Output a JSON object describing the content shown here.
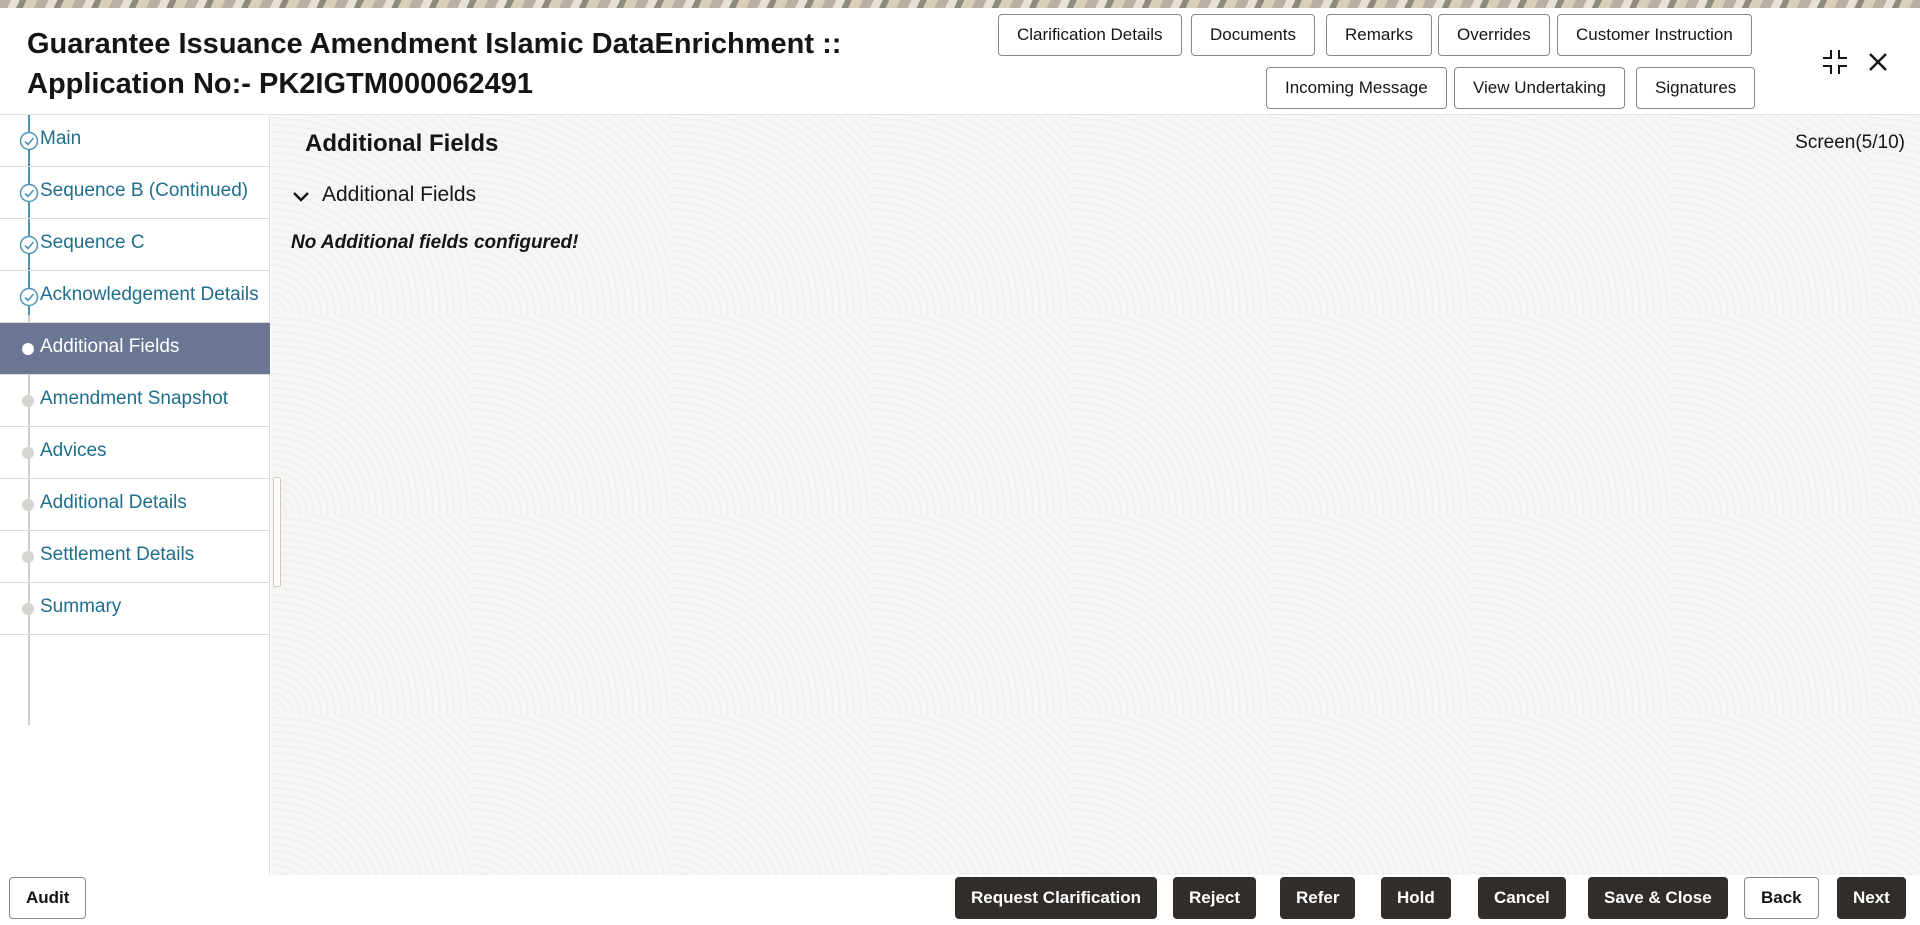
{
  "header": {
    "title_line1": "Guarantee Issuance Amendment Islamic DataEnrichment ::",
    "title_line2": "Application No:- PK2IGTM000062491",
    "buttons": {
      "clarification_details": "Clarification Details",
      "documents": "Documents",
      "remarks": "Remarks",
      "overrides": "Overrides",
      "customer_instruction": "Customer Instruction",
      "incoming_message": "Incoming Message",
      "view_undertaking": "View Undertaking",
      "signatures": "Signatures"
    },
    "icons": {
      "minimize": "collapse-icon",
      "close": "close-icon"
    }
  },
  "sidebar": {
    "items": [
      {
        "label": "Main",
        "status": "done"
      },
      {
        "label": "Sequence B (Continued)",
        "status": "done"
      },
      {
        "label": "Sequence C",
        "status": "done"
      },
      {
        "label": "Acknowledgement Details",
        "status": "done"
      },
      {
        "label": "Additional Fields",
        "status": "active"
      },
      {
        "label": "Amendment Snapshot",
        "status": "pending"
      },
      {
        "label": "Advices",
        "status": "pending"
      },
      {
        "label": "Additional Details",
        "status": "pending"
      },
      {
        "label": "Settlement Details",
        "status": "pending"
      },
      {
        "label": "Summary",
        "status": "pending"
      }
    ]
  },
  "main": {
    "section_title": "Additional Fields",
    "screen_indicator": "Screen(5/10)",
    "subsection_title": "Additional Fields",
    "empty_message": "No Additional fields configured!"
  },
  "footer": {
    "audit": "Audit",
    "request_clarification": "Request Clarification",
    "reject": "Reject",
    "refer": "Refer",
    "hold": "Hold",
    "cancel": "Cancel",
    "save_close": "Save & Close",
    "back": "Back",
    "next": "Next"
  }
}
